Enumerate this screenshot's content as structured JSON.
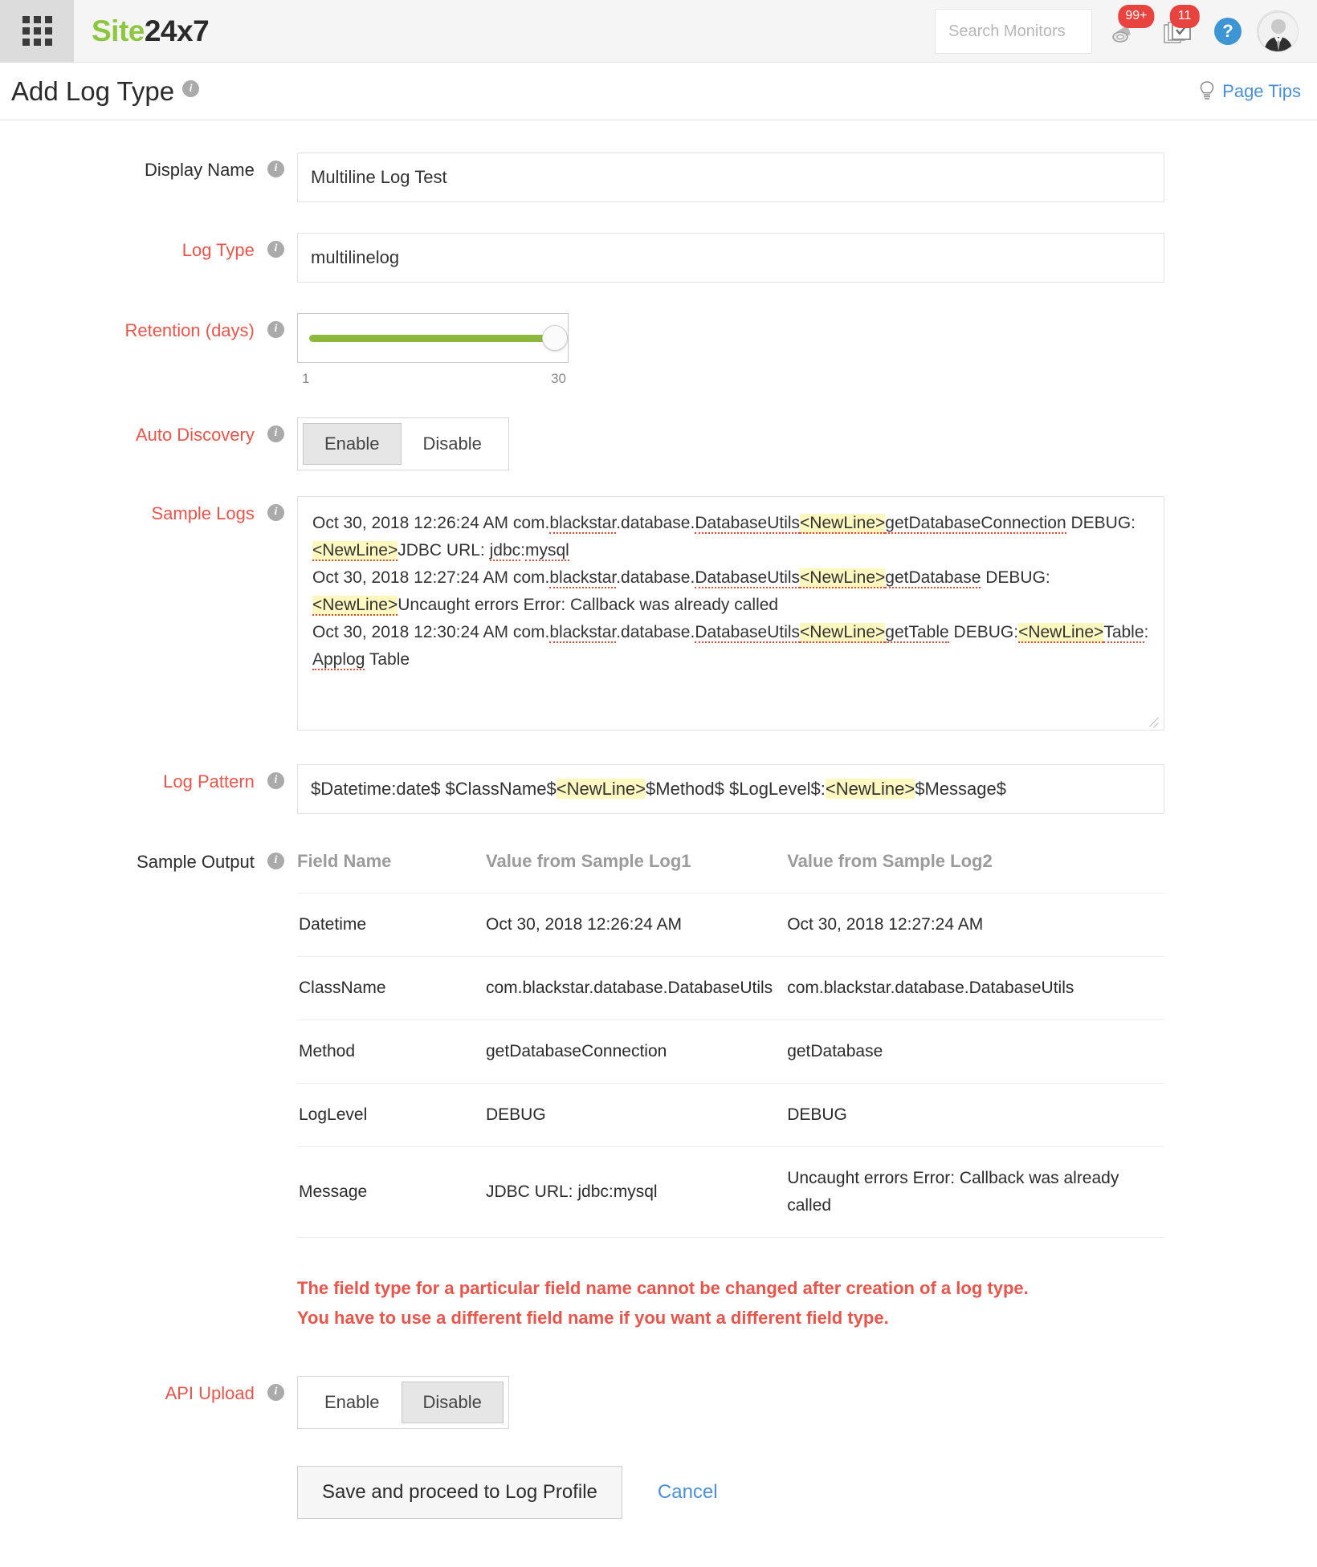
{
  "topbar": {
    "brand_green": "Site",
    "brand_dark": "24x7",
    "search_placeholder": "Search Monitors",
    "search_value": "",
    "alert_badge": "99+",
    "inbox_badge": "11",
    "help_glyph": "?"
  },
  "pagehead": {
    "title": "Add Log Type",
    "info_glyph": "i",
    "page_tips": "Page Tips"
  },
  "form": {
    "display_name": {
      "label": "Display Name",
      "value": "Multiline Log Test"
    },
    "log_type": {
      "label": "Log Type",
      "value": "multilinelog"
    },
    "retention": {
      "label": "Retention (days)",
      "min": "1",
      "max": "30",
      "value": "30"
    },
    "auto_discovery": {
      "label": "Auto Discovery",
      "enable": "Enable",
      "disable": "Disable",
      "selected": "Enable"
    },
    "sample_logs": {
      "label": "Sample Logs",
      "lines": [
        "Oct 30, 2018 12:26:24 AM com.blackstar.database.DatabaseUtils<NewLine>getDatabaseConnection DEBUG:<NewLine>JDBC URL: jdbc:mysql",
        "Oct 30, 2018 12:27:24 AM com.blackstar.database.DatabaseUtils<NewLine>getDatabase DEBUG:<NewLine>Uncaught errors Error: Callback was already called",
        "Oct 30, 2018 12:30:24 AM com.blackstar.database.DatabaseUtils<NewLine>getTable DEBUG:<NewLine>Table: Applog Table"
      ]
    },
    "log_pattern": {
      "label": "Log Pattern",
      "value": "$Datetime:date$ $ClassName$<NewLine>$Method$ $LogLevel$:<NewLine>$Message$"
    },
    "sample_output": {
      "label": "Sample Output",
      "columns": [
        "Field Name",
        "Value from Sample Log1",
        "Value from Sample Log2"
      ],
      "rows": [
        {
          "field": "Datetime",
          "log1": "Oct 30, 2018 12:26:24 AM",
          "log2": "Oct 30, 2018 12:27:24 AM"
        },
        {
          "field": "ClassName",
          "log1": "com.blackstar.database.DatabaseUtils",
          "log2": "com.blackstar.database.DatabaseUtils"
        },
        {
          "field": "Method",
          "log1": "getDatabaseConnection",
          "log2": "getDatabase"
        },
        {
          "field": "LogLevel",
          "log1": "DEBUG",
          "log2": "DEBUG"
        },
        {
          "field": "Message",
          "log1": "JDBC URL: jdbc:mysql",
          "log2": "Uncaught errors Error: Callback was already called"
        }
      ]
    },
    "warning_line1": "The field type for a particular field name cannot be changed after creation of a log type.",
    "warning_line2": "You have to use a different field name if you want a different field type.",
    "api_upload": {
      "label": "API Upload",
      "enable": "Enable",
      "disable": "Disable",
      "selected": "Disable"
    },
    "save_button": "Save and proceed to Log Profile",
    "cancel_button": "Cancel"
  },
  "colors": {
    "brand_green": "#8dc63f",
    "required_red": "#e8554a",
    "link_blue": "#4a90d9",
    "badge_red": "#e8433f",
    "highlight_yellow": "#fdf8bf",
    "slider_green": "#8cb93d"
  }
}
